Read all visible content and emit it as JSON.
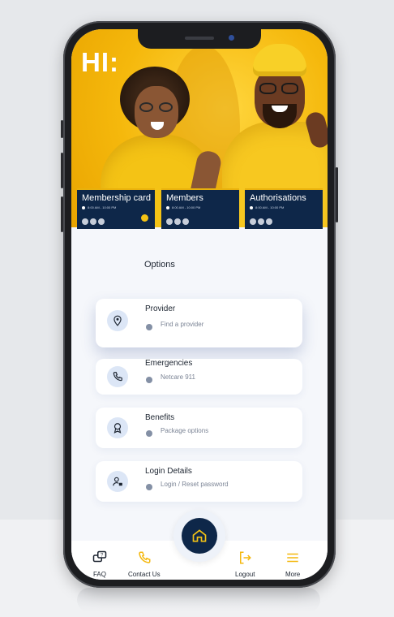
{
  "greeting": "HI:",
  "tiles": [
    {
      "title": "Membership card",
      "meta": "8:00 AM - 10:00 PM"
    },
    {
      "title": "Members",
      "meta": "8:00 AM - 10:00 PM"
    },
    {
      "title": "Authorisations",
      "meta": "8:00 AM - 10:00 PM"
    }
  ],
  "options_heading": "Options",
  "options": [
    {
      "title": "Provider",
      "subtitle": "Find a provider",
      "icon": "location-pin-icon"
    },
    {
      "title": "Emergencies",
      "subtitle": "Netcare 911",
      "icon": "phone-icon"
    },
    {
      "title": "Benefits",
      "subtitle": "Package options",
      "icon": "badge-icon"
    },
    {
      "title": "Login Details",
      "subtitle": "Login / Reset password",
      "icon": "user-lock-icon"
    }
  ],
  "nav": {
    "faq": "FAQ",
    "contact": "Contact Us",
    "logout": "Logout",
    "more": "More"
  },
  "colors": {
    "navy": "#0e2749",
    "accent_yellow": "#f4c315",
    "icon_bg": "#dce6f6"
  }
}
